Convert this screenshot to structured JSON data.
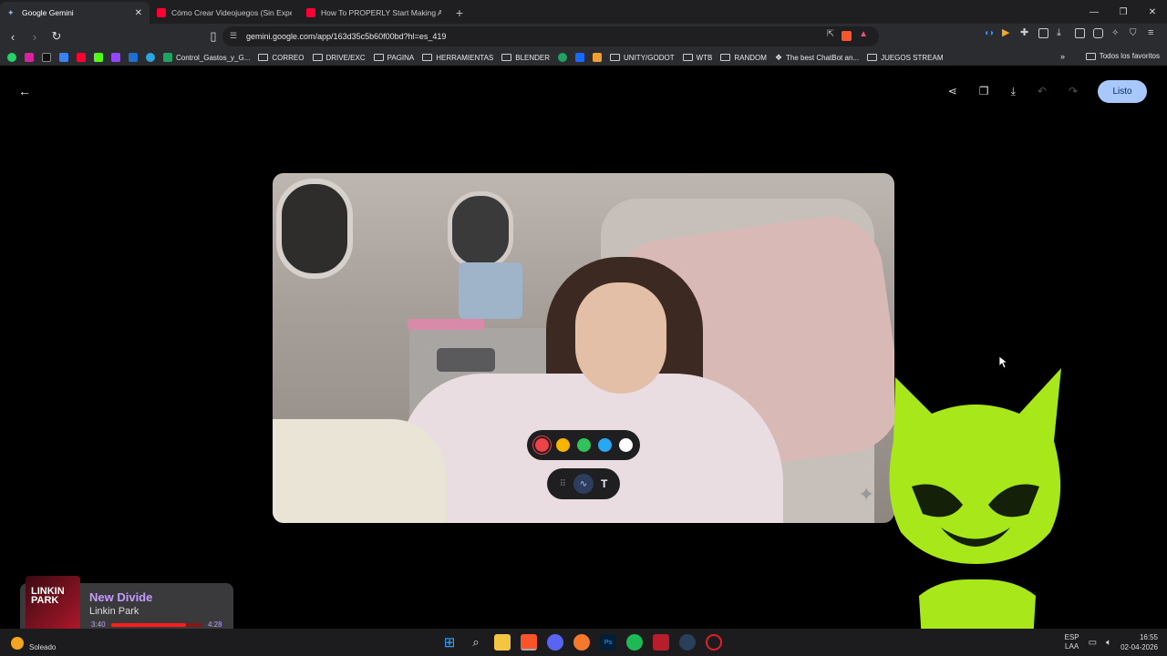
{
  "browser": {
    "tabs": [
      {
        "title": "Google Gemini",
        "active": true
      },
      {
        "title": "Cómo Crear Videojuegos (Sin Experi",
        "active": false
      },
      {
        "title": "How To PROPERLY Start Making A Ga",
        "active": false
      }
    ],
    "new_tab_symbol": "+",
    "url": "gemini.google.com/app/163d35c5b60f00bd?hl=es_419",
    "bookmarks": [
      "Control_Gastos_y_G...",
      "CORREO",
      "DRIVE/EXC",
      "PAGINA",
      "HERRAMIENTAS",
      "BLENDER",
      "UNITY/GODOT",
      "WTB",
      "RANDOM",
      "The best ChatBot an...",
      "JUEGOS STREAM"
    ],
    "bookmarks_all": "Todos los favoritos"
  },
  "editor": {
    "done_label": "Listo",
    "palette_colors": [
      "#ee4148",
      "#f7b500",
      "#2fc35a",
      "#27a8f0",
      "#ffffff"
    ],
    "text_tool_label": "T"
  },
  "now_playing": {
    "song": "New Divide",
    "artist": "Linkin Park",
    "elapsed": "3:40",
    "duration": "4:28",
    "progress": 0.82,
    "cover_text": "LINKIN PARK"
  },
  "taskbar": {
    "weather": "Soleado",
    "lang_top": "ESP",
    "lang_bottom": "LAA",
    "time": "16:55",
    "date": "02-04-2026"
  }
}
